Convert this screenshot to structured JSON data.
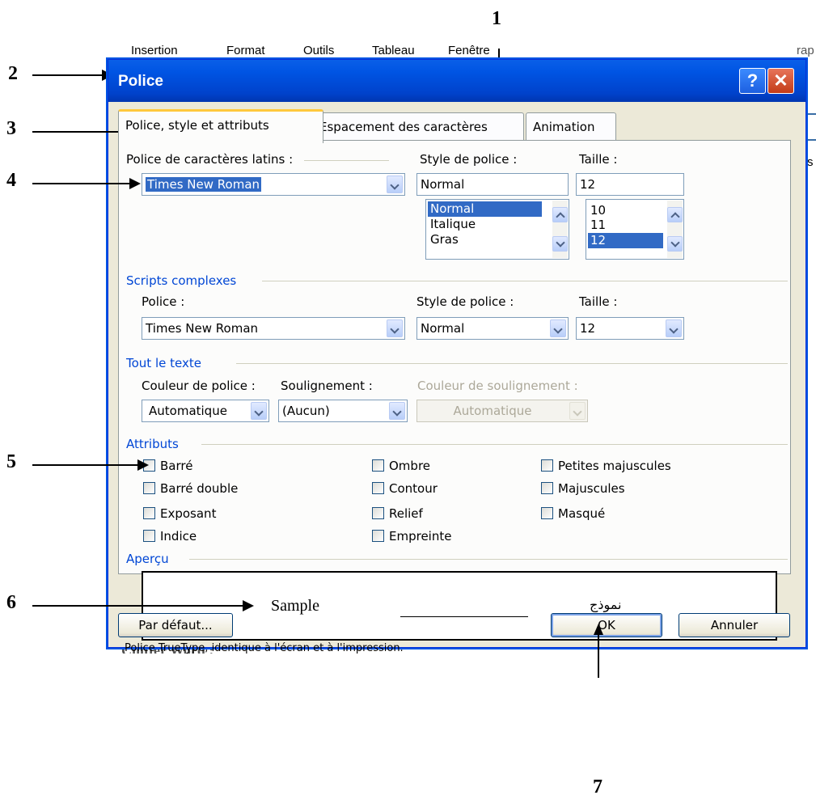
{
  "annotations": {
    "n1": "1",
    "n2": "2",
    "n3": "3",
    "n4": "4",
    "n5": "5",
    "n6": "6",
    "n7": "7"
  },
  "background": {
    "menu_items": [
      "Insertion",
      "Format",
      "Outils",
      "Tableau",
      "Fenêtre"
    ],
    "right_fragment": "rap",
    "right_side_s": "s",
    "bottom_fragment": "Chitter Word :"
  },
  "dialog": {
    "title": "Police",
    "help_glyph": "?",
    "close_glyph": "✕",
    "tabs": [
      "Police, style et attributs",
      "Espacement des caractères",
      "Animation"
    ],
    "latin": {
      "font_label": "Police de caractères latins :",
      "font_value": "Times New Roman",
      "style_label": "Style de police :",
      "style_value": "Normal",
      "style_options": [
        "Normal",
        "Italique",
        "Gras"
      ],
      "style_selected": "Normal",
      "size_label": "Taille :",
      "size_value": "12",
      "size_options": [
        "10",
        "11",
        "12"
      ],
      "size_selected": "12"
    },
    "complex": {
      "group_label": "Scripts complexes",
      "font_label": "Police :",
      "font_value": "Times New Roman",
      "style_label": "Style de police :",
      "style_value": "Normal",
      "size_label": "Taille :",
      "size_value": "12"
    },
    "all_text": {
      "group_label": "Tout le texte",
      "color_label": "Couleur de police :",
      "color_value": "Automatique",
      "underline_label": "Soulignement :",
      "underline_value": "(Aucun)",
      "underline_color_label": "Couleur de soulignement :",
      "underline_color_value": "Automatique"
    },
    "attributes": {
      "group_label": "Attributs",
      "col1": [
        "Barré",
        "Barré double",
        "Exposant",
        "Indice"
      ],
      "col2": [
        "Ombre",
        "Contour",
        "Relief",
        "Empreinte"
      ],
      "col3": [
        "Petites majuscules",
        "Majuscules",
        "Masqué"
      ]
    },
    "preview": {
      "group_label": "Aperçu",
      "latin_sample": "Sample",
      "arabic_sample": "نموذج",
      "description": "Police TrueType, identique à l'écran et à l'impression."
    },
    "buttons": {
      "default": "Par défaut...",
      "ok": "OK",
      "cancel": "Annuler"
    }
  },
  "colors": {
    "titlebar": "#0054e3",
    "dialog_bg": "#ece9d8",
    "group_label": "#0046d5",
    "selection": "#316ac5"
  }
}
